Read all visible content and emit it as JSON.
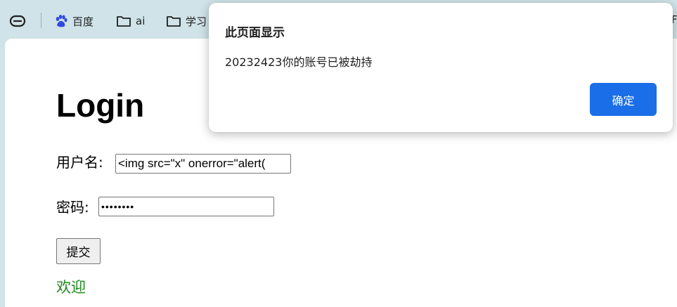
{
  "bookmarks": {
    "items": [
      {
        "label": "百度",
        "icon": "baidu-paw-icon"
      },
      {
        "label": "ai",
        "icon": "folder-icon"
      },
      {
        "label": "学习",
        "icon": "folder-icon"
      }
    ],
    "overflow_label": "F"
  },
  "page": {
    "title": "Login",
    "username_label": "用户名:",
    "username_value": "<img src=\"x\" onerror=\"alert(",
    "password_label": "密码:",
    "password_value": "••••••••",
    "submit_label": "提交",
    "welcome_text": "欢迎"
  },
  "dialog": {
    "title": "此页面显示",
    "message": "20232423你的账号已被劫持",
    "ok_label": "确定"
  },
  "colors": {
    "bookmark_bar_bg": "#cfe3e8",
    "dialog_button": "#1a6ee8",
    "welcome_text": "#1f8a1f"
  }
}
